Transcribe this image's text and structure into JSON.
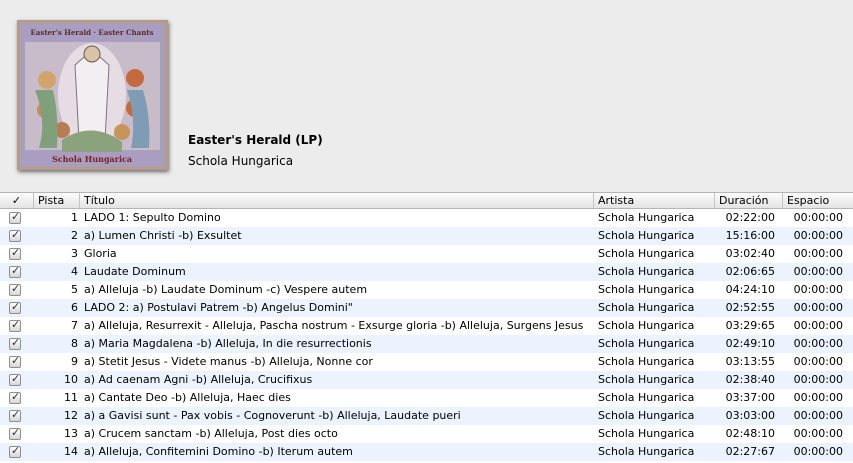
{
  "album": {
    "title": "Easter's Herald (LP)",
    "artist": "Schola Hungarica",
    "cover_text_top": "Easter's Herald · Easter Chants",
    "cover_text_bottom": "Schola Hungarica"
  },
  "columns": {
    "check": "✓",
    "track": "Pista",
    "title": "Título",
    "artist": "Artista",
    "duration": "Duración",
    "space": "Espacio"
  },
  "tracks": [
    {
      "num": "1",
      "title": "LADO 1: Sepulto Domino",
      "artist": "Schola Hungarica",
      "duration": "02:22:00",
      "space": "00:00:00"
    },
    {
      "num": "2",
      "title": "a) Lumen Christi -b) Exsultet",
      "artist": "Schola Hungarica",
      "duration": "15:16:00",
      "space": "00:00:00"
    },
    {
      "num": "3",
      "title": "Gloria",
      "artist": "Schola Hungarica",
      "duration": "03:02:40",
      "space": "00:00:00"
    },
    {
      "num": "4",
      "title": "Laudate Dominum",
      "artist": "Schola Hungarica",
      "duration": "02:06:65",
      "space": "00:00:00"
    },
    {
      "num": "5",
      "title": "a) Alleluja -b) Laudate Dominum -c) Vespere autem",
      "artist": "Schola Hungarica",
      "duration": "04:24:10",
      "space": "00:00:00"
    },
    {
      "num": "6",
      "title": "LADO 2: a) Postulavi Patrem -b) Angelus Domini\"",
      "artist": "Schola Hungarica",
      "duration": "02:52:55",
      "space": "00:00:00"
    },
    {
      "num": "7",
      "title": "a) Alleluja, Resurrexit - Alleluja, Pascha nostrum - Exsurge gloria -b) Alleluja, Surgens Jesus",
      "artist": "Schola Hungarica",
      "duration": "03:29:65",
      "space": "00:00:00"
    },
    {
      "num": "8",
      "title": "a) Maria Magdalena -b) Alleluja, In die resurrectionis",
      "artist": "Schola Hungarica",
      "duration": "02:49:10",
      "space": "00:00:00"
    },
    {
      "num": "9",
      "title": "a) Stetit Jesus - Videte manus -b) Alleluja, Nonne cor",
      "artist": "Schola Hungarica",
      "duration": "03:13:55",
      "space": "00:00:00"
    },
    {
      "num": "10",
      "title": "a) Ad caenam Agni -b) Alleluja, Crucifixus",
      "artist": "Schola Hungarica",
      "duration": "02:38:40",
      "space": "00:00:00"
    },
    {
      "num": "11",
      "title": "a) Cantate Deo -b) Alleluja, Haec dies",
      "artist": "Schola Hungarica",
      "duration": "03:37:00",
      "space": "00:00:00"
    },
    {
      "num": "12",
      "title": "a) a Gavisi sunt - Pax vobis - Cognoverunt -b) Alleluja, Laudate pueri",
      "artist": "Schola Hungarica",
      "duration": "03:03:00",
      "space": "00:00:00"
    },
    {
      "num": "13",
      "title": "a) Crucem sanctam -b) Alleluja, Post dies octo",
      "artist": "Schola Hungarica",
      "duration": "02:48:10",
      "space": "00:00:00"
    },
    {
      "num": "14",
      "title": "a) Alleluja, Confitemini Domino -b) Iterum autem",
      "artist": "Schola Hungarica",
      "duration": "02:27:67",
      "space": "00:00:00"
    }
  ]
}
